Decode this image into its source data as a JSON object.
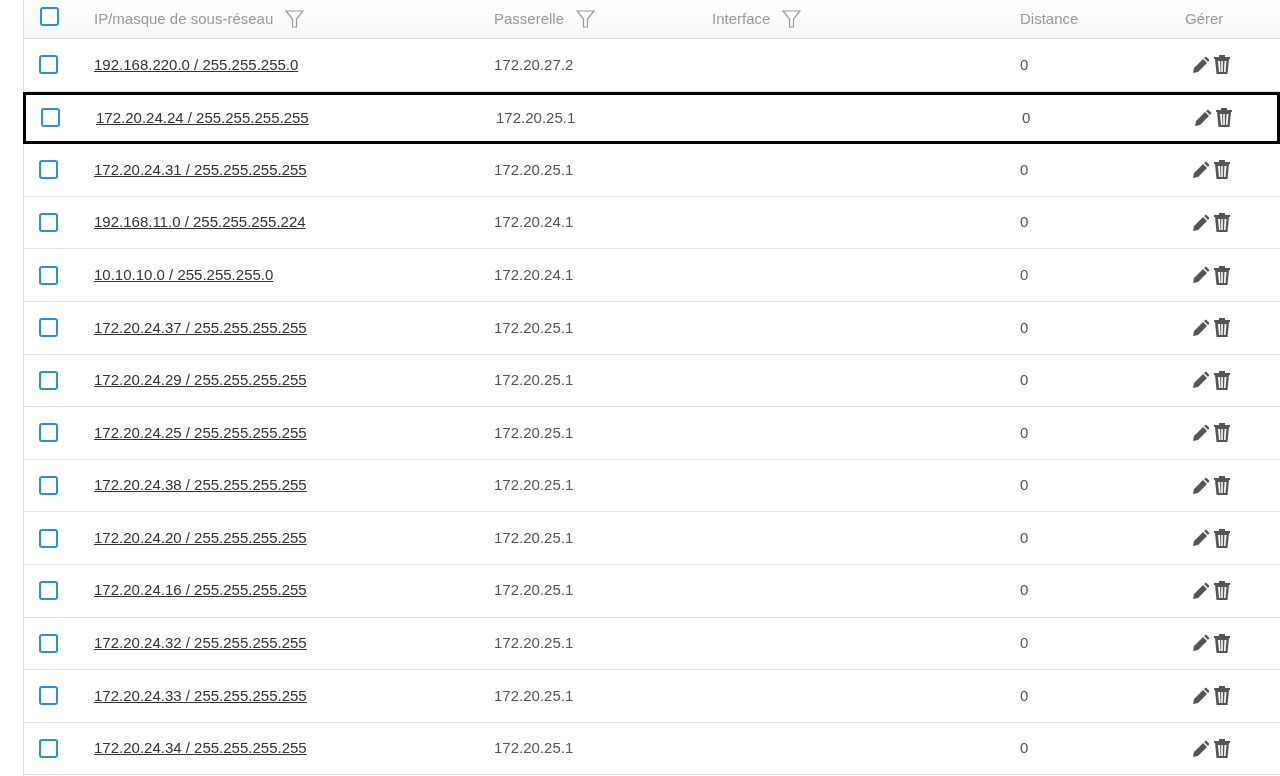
{
  "table": {
    "header_checkbox": {
      "checked": false
    },
    "columns": [
      {
        "label": "IP/masque de sous-réseau",
        "filter": true
      },
      {
        "label": "Passerelle",
        "filter": true
      },
      {
        "label": "Interface",
        "filter": true
      },
      {
        "label": "Distance",
        "filter": false
      },
      {
        "label": "Gérer",
        "filter": false
      }
    ],
    "rows": [
      {
        "checked": false,
        "highlighted": false,
        "network": "192.168.220.0 / 255.255.255.0",
        "gateway": "172.20.27.2",
        "distance": "0"
      },
      {
        "checked": false,
        "highlighted": true,
        "network": "172.20.24.24 / 255.255.255.255",
        "gateway": "172.20.25.1",
        "distance": "0"
      },
      {
        "checked": false,
        "highlighted": false,
        "network": "172.20.24.31 / 255.255.255.255",
        "gateway": "172.20.25.1",
        "distance": "0"
      },
      {
        "checked": false,
        "highlighted": false,
        "network": "192.168.11.0 / 255.255.255.224",
        "gateway": "172.20.24.1",
        "distance": "0"
      },
      {
        "checked": false,
        "highlighted": false,
        "network": "10.10.10.0 / 255.255.255.0",
        "gateway": "172.20.24.1",
        "distance": "0"
      },
      {
        "checked": false,
        "highlighted": false,
        "network": "172.20.24.37 / 255.255.255.255",
        "gateway": "172.20.25.1",
        "distance": "0"
      },
      {
        "checked": false,
        "highlighted": false,
        "network": "172.20.24.29 / 255.255.255.255",
        "gateway": "172.20.25.1",
        "distance": "0"
      },
      {
        "checked": false,
        "highlighted": false,
        "network": "172.20.24.25 / 255.255.255.255",
        "gateway": "172.20.25.1",
        "distance": "0"
      },
      {
        "checked": false,
        "highlighted": false,
        "network": "172.20.24.38 / 255.255.255.255",
        "gateway": "172.20.25.1",
        "distance": "0"
      },
      {
        "checked": false,
        "highlighted": false,
        "network": "172.20.24.20 / 255.255.255.255",
        "gateway": "172.20.25.1",
        "distance": "0"
      },
      {
        "checked": false,
        "highlighted": false,
        "network": "172.20.24.16 / 255.255.255.255",
        "gateway": "172.20.25.1",
        "distance": "0"
      },
      {
        "checked": false,
        "highlighted": false,
        "network": "172.20.24.32 / 255.255.255.255",
        "gateway": "172.20.25.1",
        "distance": "0"
      },
      {
        "checked": false,
        "highlighted": false,
        "network": "172.20.24.33 / 255.255.255.255",
        "gateway": "172.20.25.1",
        "distance": "0"
      },
      {
        "checked": false,
        "highlighted": false,
        "network": "172.20.24.34 / 255.255.255.255",
        "gateway": "172.20.25.1",
        "distance": "0"
      }
    ]
  }
}
